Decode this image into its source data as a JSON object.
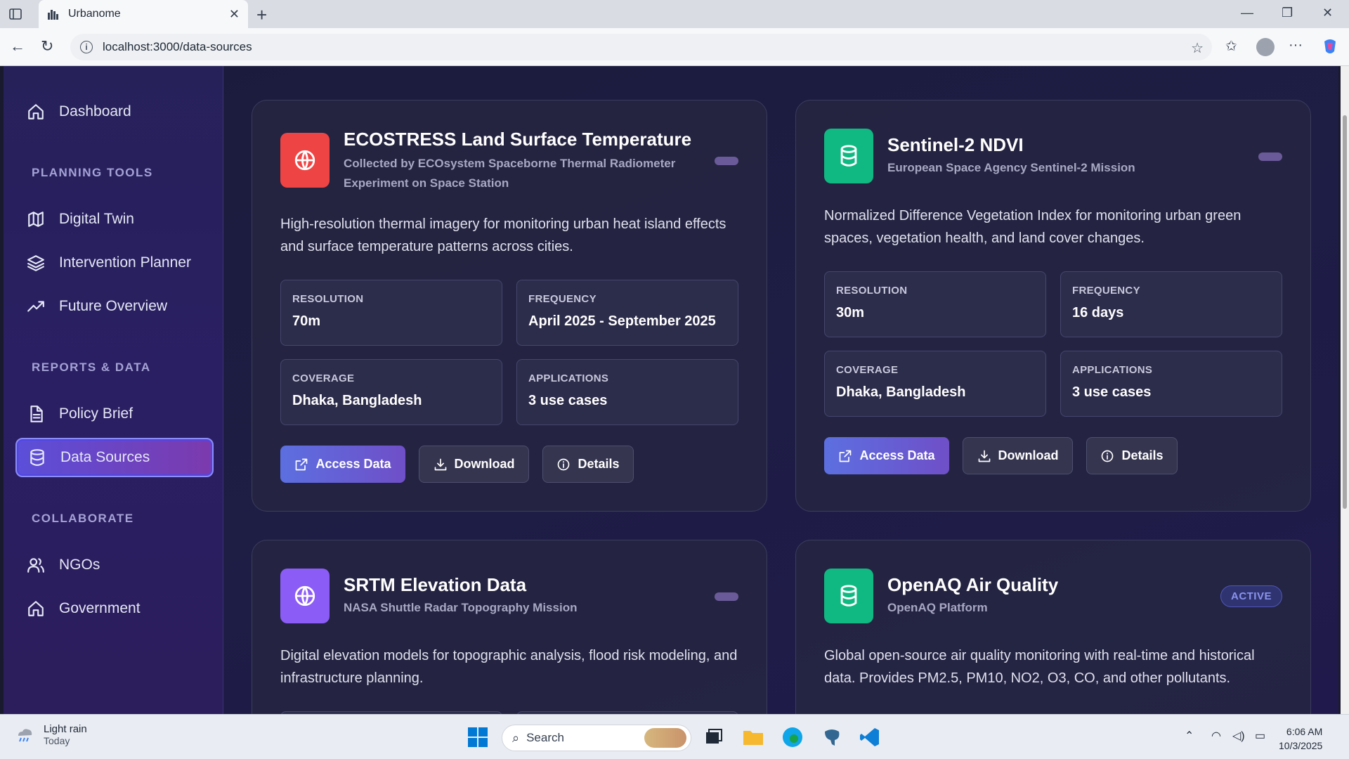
{
  "browser": {
    "tab_title": "Urbanome",
    "url": "localhost:3000/data-sources"
  },
  "sidebar": {
    "dashboard": "Dashboard",
    "sections": [
      {
        "label": "PLANNING TOOLS",
        "items": [
          "Digital Twin",
          "Intervention Planner",
          "Future Overview"
        ]
      },
      {
        "label": "REPORTS & DATA",
        "items": [
          "Policy Brief",
          "Data Sources"
        ]
      },
      {
        "label": "COLLABORATE",
        "items": [
          "NGOs",
          "Government"
        ]
      }
    ],
    "active_item": "Data Sources"
  },
  "cards": [
    {
      "title": "ECOSTRESS Land Surface Temperature",
      "subtitle": "Collected by ECOsystem Spaceborne Thermal Radiometer Experiment on Space Station",
      "icon": "globe-icon",
      "icon_color": "#ef4444",
      "description": "High-resolution thermal imagery for monitoring urban heat island effects and surface temperature patterns across cities.",
      "stats": [
        {
          "label": "RESOLUTION",
          "value": "70m"
        },
        {
          "label": "FREQUENCY",
          "value": "April 2025 - September 2025"
        },
        {
          "label": "COVERAGE",
          "value": "Dhaka, Bangladesh"
        },
        {
          "label": "APPLICATIONS",
          "value": "3 use cases"
        }
      ],
      "buttons": {
        "access": "Access Data",
        "download": "Download",
        "details": "Details"
      }
    },
    {
      "title": "Sentinel-2 NDVI",
      "subtitle": "European Space Agency Sentinel-2 Mission",
      "icon": "database-icon",
      "icon_color": "#10b981",
      "description": "Normalized Difference Vegetation Index for monitoring urban green spaces, vegetation health, and land cover changes.",
      "stats": [
        {
          "label": "RESOLUTION",
          "value": "30m"
        },
        {
          "label": "FREQUENCY",
          "value": "16 days"
        },
        {
          "label": "COVERAGE",
          "value": "Dhaka, Bangladesh"
        },
        {
          "label": "APPLICATIONS",
          "value": "3 use cases"
        }
      ],
      "buttons": {
        "access": "Access Data",
        "download": "Download",
        "details": "Details"
      }
    },
    {
      "title": "SRTM Elevation Data",
      "subtitle": "NASA Shuttle Radar Topography Mission",
      "icon": "globe-icon",
      "icon_color": "#8b5cf6",
      "description": "Digital elevation models for topographic analysis, flood risk modeling, and infrastructure planning."
    },
    {
      "title": "OpenAQ Air Quality",
      "subtitle": "OpenAQ Platform",
      "icon": "database-icon",
      "icon_color": "#10b981",
      "badge": "ACTIVE",
      "description": "Global open-source air quality monitoring with real-time and historical data. Provides PM2.5, PM10, NO2, O3, CO, and other pollutants."
    }
  ],
  "taskbar": {
    "weather_title": "Light rain",
    "weather_sub": "Today",
    "search_placeholder": "Search",
    "time": "6:06 AM",
    "date": "10/3/2025"
  }
}
